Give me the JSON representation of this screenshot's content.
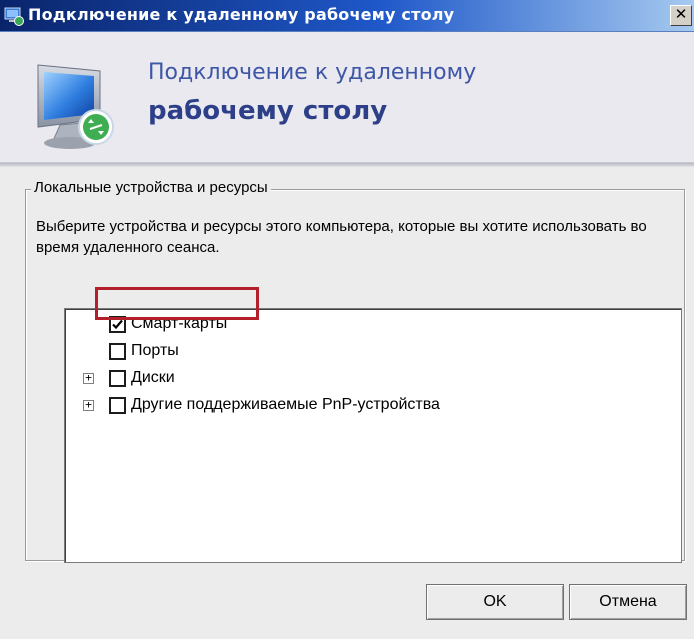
{
  "window": {
    "title": "Подключение к удаленному рабочему столу",
    "close_glyph": "✕"
  },
  "banner": {
    "line1": "Подключение к удаленному",
    "line2": "рабочему столу",
    "icon": "remote-desktop-monitor-icon"
  },
  "group": {
    "legend": "Локальные устройства и ресурсы",
    "description": "Выберите устройства и ресурсы этого компьютера, которые вы хотите использовать во время удаленного сеанса."
  },
  "tree": {
    "items": [
      {
        "label": "Смарт-карты",
        "checked": true,
        "expandable": false
      },
      {
        "label": "Порты",
        "checked": false,
        "expandable": false
      },
      {
        "label": "Диски",
        "checked": false,
        "expandable": true
      },
      {
        "label": "Другие поддерживаемые PnP-устройства",
        "checked": false,
        "expandable": true
      }
    ],
    "expander_glyph": "+"
  },
  "buttons": {
    "ok": "OK",
    "cancel": "Отмена"
  },
  "colors": {
    "highlight": "#b3202a",
    "banner_text": "#3d56a6",
    "title_bar": "#0a246a"
  }
}
